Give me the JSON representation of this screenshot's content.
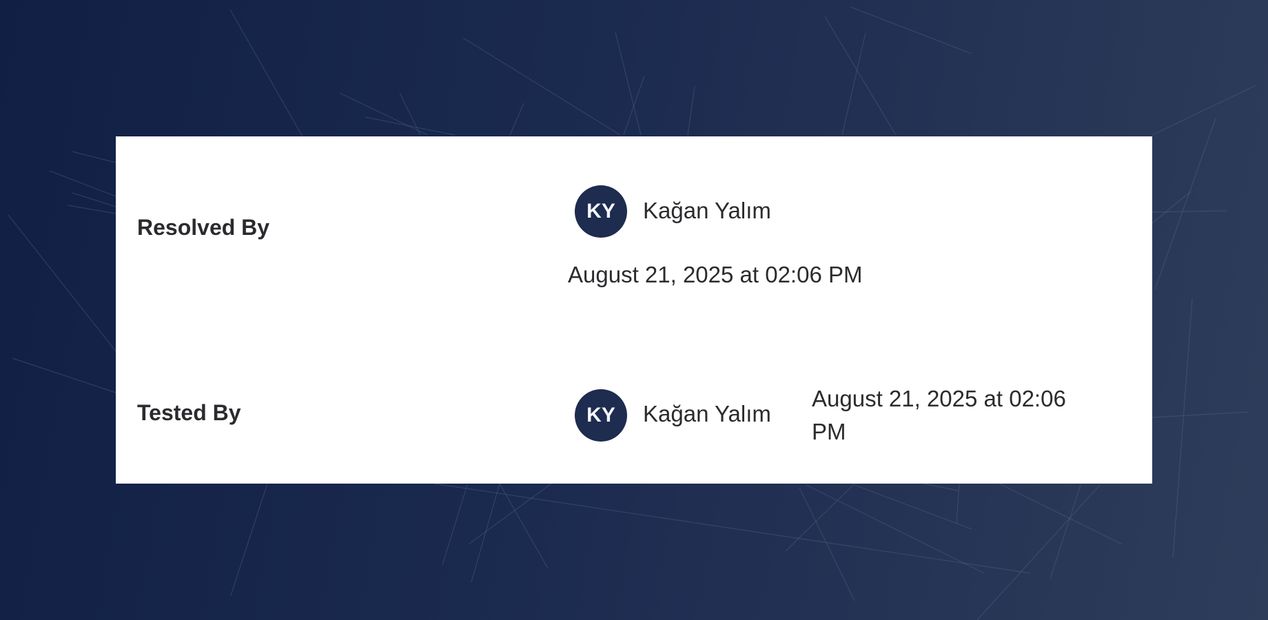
{
  "theme": {
    "avatar_color": "#1d2c4f",
    "card_background": "#ffffff",
    "page_background": "#111f45"
  },
  "resolved": {
    "label": "Resolved By",
    "avatar_initials": "KY",
    "user_name": "Kağan Yalım",
    "timestamp": "August 21, 2025 at 02:06 PM"
  },
  "tested": {
    "label": "Tested By",
    "avatar_initials": "KY",
    "user_name": "Kağan Yalım",
    "timestamp": "August 21, 2025 at 02:06 PM"
  }
}
